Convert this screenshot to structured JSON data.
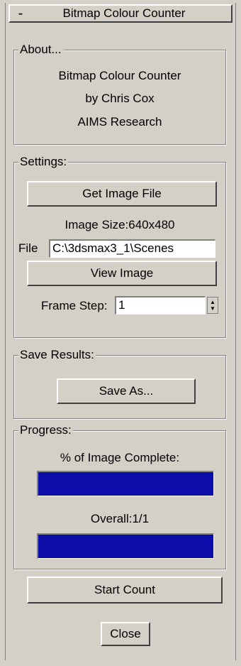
{
  "rollout": {
    "toggle": "-",
    "title": "Bitmap Colour Counter"
  },
  "about": {
    "legend": "About...",
    "line1": "Bitmap Colour Counter",
    "line2": "by Chris Cox",
    "line3": "AIMS Research"
  },
  "settings": {
    "legend": "Settings:",
    "get_image_label": "Get Image File",
    "image_size_text": "Image Size:640x480",
    "file_label": "File",
    "file_value": "C:\\3dsmax3_1\\Scenes",
    "view_image_label": "View Image",
    "frame_step_label": "Frame Step:",
    "frame_step_value": "1"
  },
  "save_results": {
    "legend": "Save Results:",
    "save_as_label": "Save As..."
  },
  "progress": {
    "legend": "Progress:",
    "image_complete_label": "% of Image Complete:",
    "image_complete_fraction": 1.0,
    "overall_label": "Overall:1/1",
    "overall_fraction": 1.0
  },
  "actions": {
    "start_count_label": "Start Count",
    "close_label": "Close"
  },
  "colors": {
    "progress_fill": "#0c0ca8",
    "face": "#d4d0c8"
  }
}
